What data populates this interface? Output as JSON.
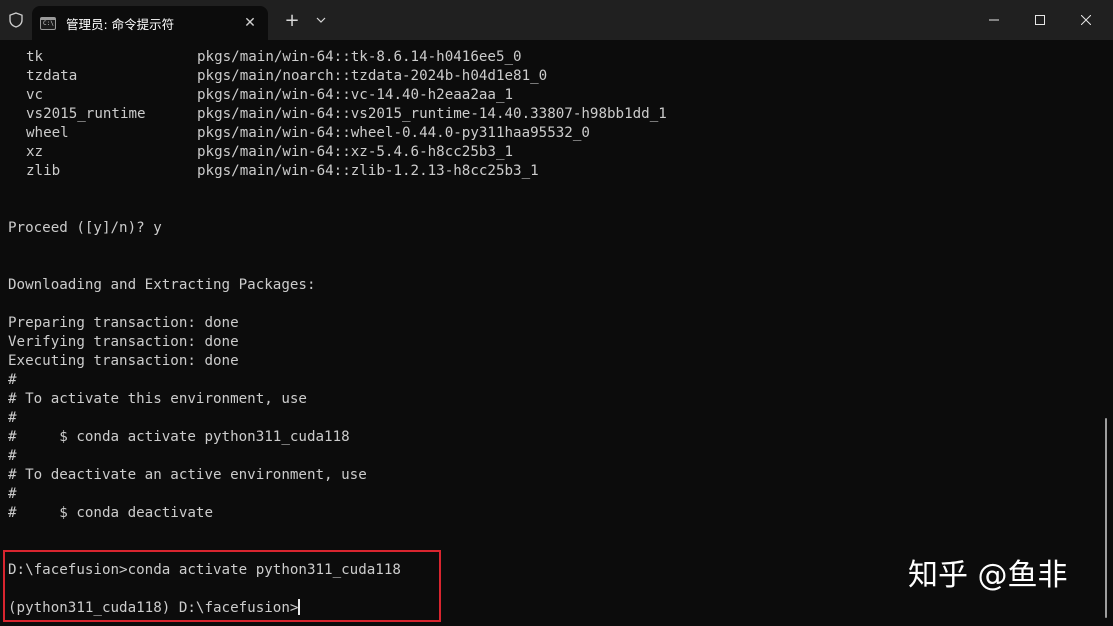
{
  "titlebar": {
    "tab_title": "管理员: 命令提示符",
    "tab_icon_text": "C:\\",
    "close_tab": "✕",
    "new_tab": "+",
    "dropdown": "⌵"
  },
  "terminal": {
    "packages": [
      {
        "name": "tk",
        "spec": "pkgs/main/win-64::tk-8.6.14-h0416ee5_0"
      },
      {
        "name": "tzdata",
        "spec": "pkgs/main/noarch::tzdata-2024b-h04d1e81_0"
      },
      {
        "name": "vc",
        "spec": "pkgs/main/win-64::vc-14.40-h2eaa2aa_1"
      },
      {
        "name": "vs2015_runtime",
        "spec": "pkgs/main/win-64::vs2015_runtime-14.40.33807-h98bb1dd_1"
      },
      {
        "name": "wheel",
        "spec": "pkgs/main/win-64::wheel-0.44.0-py311haa95532_0"
      },
      {
        "name": "xz",
        "spec": "pkgs/main/win-64::xz-5.4.6-h8cc25b3_1"
      },
      {
        "name": "zlib",
        "spec": "pkgs/main/win-64::zlib-1.2.13-h8cc25b3_1"
      }
    ],
    "proceed": "Proceed ([y]/n)? y",
    "downloading": "Downloading and Extracting Packages:",
    "preparing": "Preparing transaction: done",
    "verifying": "Verifying transaction: done",
    "executing": "Executing transaction: done",
    "hash1": "#",
    "activate_note": "# To activate this environment, use",
    "hash2": "#",
    "activate_cmd": "#     $ conda activate python311_cuda118",
    "hash3": "#",
    "deactivate_note": "# To deactivate an active environment, use",
    "hash4": "#",
    "deactivate_cmd": "#     $ conda deactivate",
    "command_line": "D:\\facefusion>conda activate python311_cuda118",
    "prompt": "(python311_cuda118) D:\\facefusion>"
  },
  "watermark": "知乎 @鱼非",
  "colors": {
    "background": "#0c0c0c",
    "titlebar": "#202020",
    "text": "#cccccc",
    "highlight_border": "#d9252f"
  }
}
